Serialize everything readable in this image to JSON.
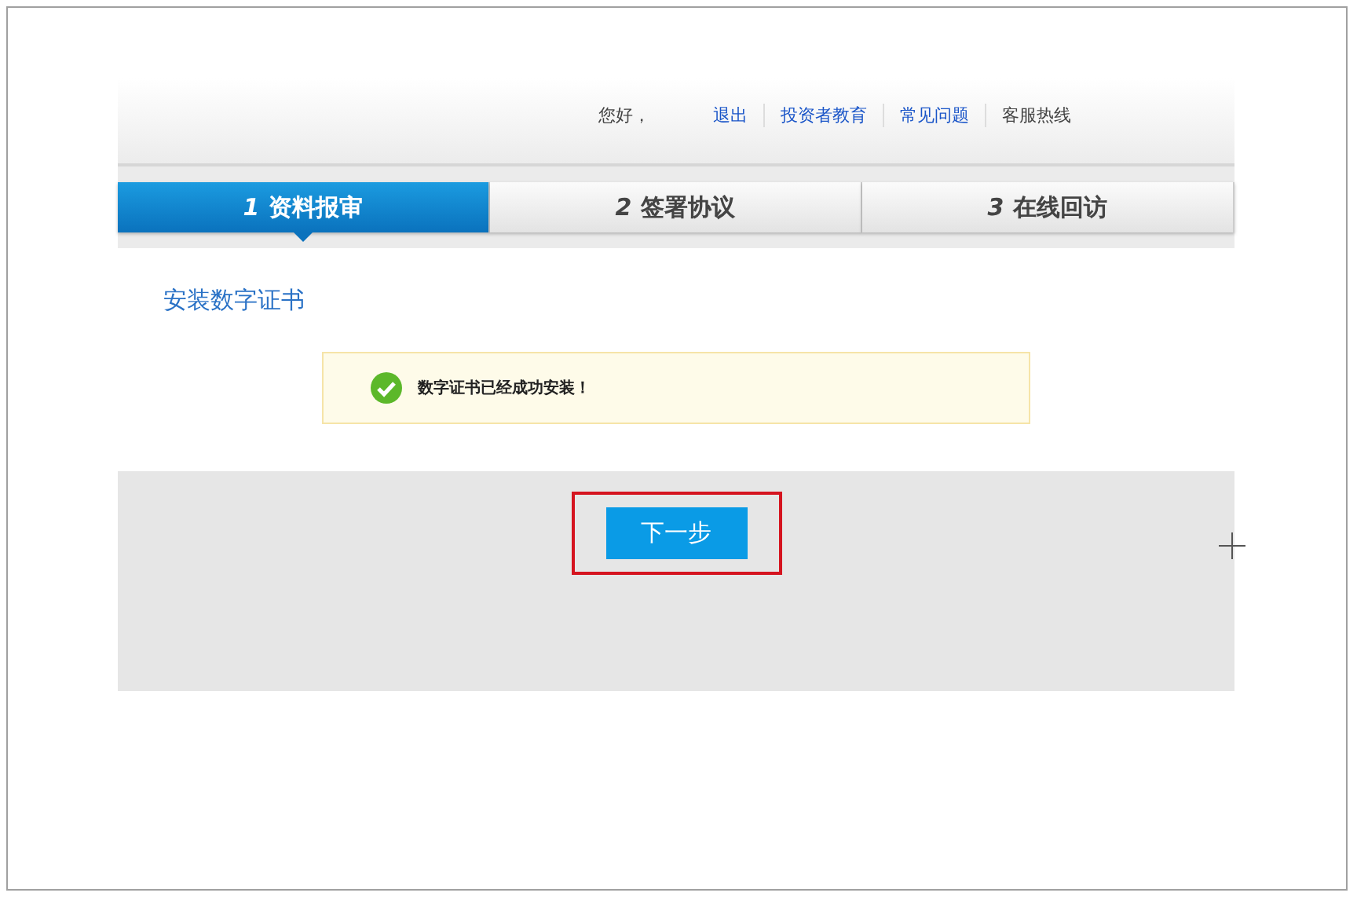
{
  "header": {
    "greeting": "您好，",
    "links": [
      {
        "label": "退出"
      },
      {
        "label": "投资者教育"
      },
      {
        "label": "常见问题"
      }
    ],
    "hotline_label": "客服热线"
  },
  "steps": [
    {
      "number": "1",
      "label": "资料报审",
      "selected": true
    },
    {
      "number": "2",
      "label": "签署协议",
      "selected": false
    },
    {
      "number": "3",
      "label": "在线回访",
      "selected": false
    }
  ],
  "section_title": "安装数字证书",
  "notice": {
    "message": "数字证书已经成功安装！"
  },
  "next_button": {
    "label": "下一步",
    "highlighted": true
  }
}
